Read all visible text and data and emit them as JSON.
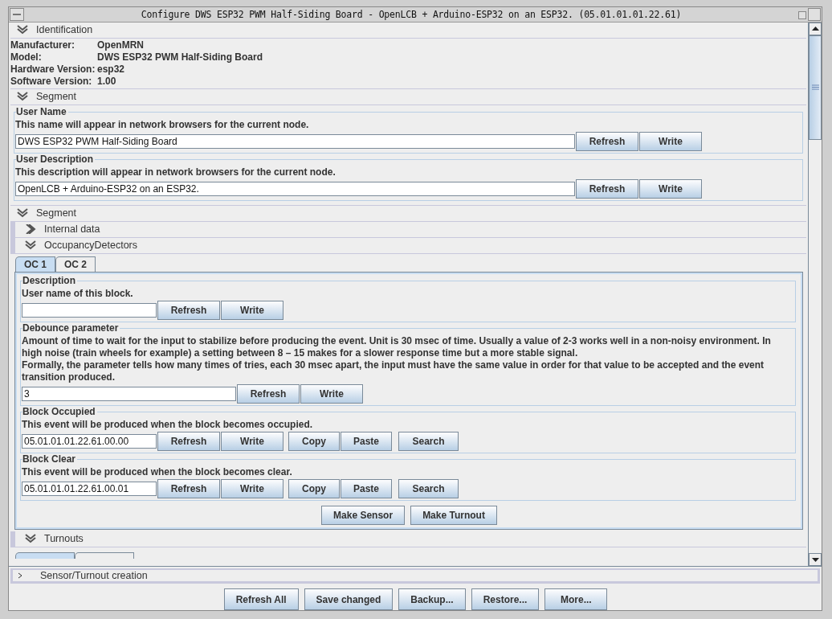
{
  "window": {
    "title": "Configure DWS ESP32 PWM Half-Siding Board - OpenLCB + Arduino-ESP32 on an ESP32. (05.01.01.01.22.61)"
  },
  "identification": {
    "header": "Identification",
    "expanded": true,
    "fields": [
      {
        "label": "Manufacturer:",
        "value": "OpenMRN"
      },
      {
        "label": "Model:",
        "value": "DWS ESP32 PWM Half-Siding Board"
      },
      {
        "label": "Hardware Version:",
        "value": "esp32"
      },
      {
        "label": "Software Version:",
        "value": "1.00"
      }
    ]
  },
  "segments": [
    {
      "header": "Segment",
      "expanded": true,
      "groups": [
        {
          "title": "User Name",
          "kind": "long",
          "description": [
            "This name will appear in network browsers for the current node."
          ],
          "value": "DWS ESP32 PWM Half-Siding Board",
          "buttons": [
            "Refresh",
            "Write"
          ]
        },
        {
          "title": "User Description",
          "kind": "long",
          "description": [
            "This description will appear in network browsers for the current node."
          ],
          "value": "OpenLCB + Arduino-ESP32 on an ESP32.",
          "buttons": [
            "Refresh",
            "Write"
          ]
        }
      ]
    },
    {
      "header": "Segment",
      "expanded": true,
      "subsections": [
        {
          "header": "Internal data",
          "expanded": false
        },
        {
          "header": "OccupancyDetectors",
          "expanded": true,
          "tabs": [
            {
              "label": "OC 1",
              "selected": true
            },
            {
              "label": "OC 2",
              "selected": false
            }
          ],
          "groups": [
            {
              "title": "Description",
              "kind": "short",
              "description": [
                "User name of this block."
              ],
              "buttons": [
                "Refresh",
                "Write"
              ]
            },
            {
              "title": "Debounce parameter",
              "kind": "medium",
              "description": [
                "Amount of time to wait for the input to stabilize before producing the event. Unit is 30 msec of time. Usually a value of 2-3 works well in a non-noisy environment. In high noise (train wheels for example) a setting between 8 – 15 makes for a slower response time but a more stable signal.",
                "Formally, the parameter tells how many times of tries, each 30 msec apart, the input must have the same value in order for that value to be accepted and the event transition produced."
              ],
              "value": "3",
              "buttons": [
                "Refresh",
                "Write"
              ]
            },
            {
              "title": "Block Occupied",
              "kind": "short",
              "description": [
                "This event will be produced when the block becomes occupied."
              ],
              "value": "05.01.01.01.22.61.00.00",
              "buttons": [
                "Refresh",
                "Write",
                "Copy",
                "Paste",
                "Search"
              ]
            },
            {
              "title": "Block Clear",
              "kind": "short",
              "description": [
                "This event will be produced when the block becomes clear."
              ],
              "value": "05.01.01.01.22.61.00.01",
              "buttons": [
                "Refresh",
                "Write",
                "Copy",
                "Paste",
                "Search"
              ]
            }
          ],
          "actions": [
            "Make Sensor",
            "Make Turnout"
          ]
        },
        {
          "header": "Turnouts",
          "expanded": true
        }
      ]
    }
  ],
  "footer_section": {
    "header": "Sensor/Turnout creation",
    "expanded": false
  },
  "buttons": [
    "Refresh All",
    "Save changed",
    "Backup...",
    "Restore...",
    "More..."
  ]
}
